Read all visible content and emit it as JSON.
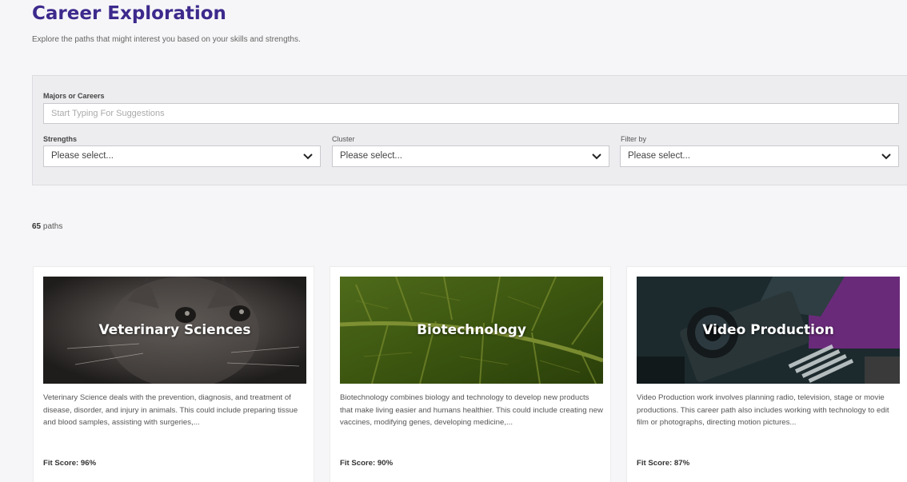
{
  "header": {
    "title": "Career Exploration",
    "subtitle": "Explore the paths that might interest you based on your skills and strengths."
  },
  "filters": {
    "search_label": "Majors or Careers",
    "search_placeholder": "Start Typing For Suggestions",
    "strengths_label": "Strengths",
    "strengths_value": "Please select...",
    "cluster_label": "Cluster",
    "cluster_value": "Please select...",
    "filter_by_label": "Filter by",
    "filter_by_value": "Please select..."
  },
  "results": {
    "count_number": "65",
    "count_suffix": " paths"
  },
  "cards": [
    {
      "title": "Veterinary Sciences",
      "image": "kitten-photo",
      "description": "Veterinary Science deals with the prevention, diagnosis, and treatment of disease, disorder, and injury in animals. This could include preparing tissue and blood samples, assisting with surgeries,...",
      "fit_score": "Fit Score: 96%"
    },
    {
      "title": "Biotechnology",
      "image": "leaf-photo",
      "description": "Biotechnology combines biology and technology to develop new products that make living easier and humans healthier. This could include creating new vaccines, modifying genes, developing medicine,...",
      "fit_score": "Fit Score: 90%"
    },
    {
      "title": "Video Production",
      "image": "camera-photo",
      "description": "Video Production work involves planning radio, television, stage or movie productions. This career path also includes working with technology to edit film or photographs, directing motion pictures...",
      "fit_score": "Fit Score: 87%"
    }
  ],
  "colors": {
    "title": "#3d2a8c",
    "panel": "#ededf0",
    "background": "#f6f6f8"
  }
}
